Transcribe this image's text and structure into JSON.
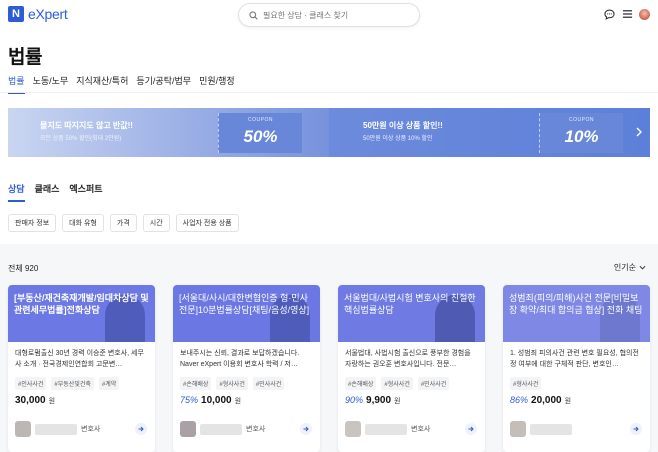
{
  "header": {
    "logo_mark": "N",
    "logo_text": "eXpert",
    "search_placeholder": "필요한 상담 · 클래스 찾기"
  },
  "page_title": "법률",
  "category_tabs": [
    "법률",
    "노동/노무",
    "지식재산/특허",
    "등기/공탁/법무",
    "민원/행정"
  ],
  "banner": {
    "left": {
      "title": "몰지도 따지지도 않고 반값!!",
      "subtitle": "모든 상품 50% 할인(최대 2만원)",
      "coupon_label": "COUPON",
      "coupon_value": "50%"
    },
    "right": {
      "title": "50만원 이상 상품 할인!!",
      "subtitle": "50만원 이상 상품 10% 할인",
      "coupon_label": "COUPON",
      "coupon_value": "10%"
    }
  },
  "sub_tabs": [
    "상담",
    "클래스",
    "엑스퍼트"
  ],
  "filters": [
    "판매자 정보",
    "대화 유형",
    "가격",
    "시간",
    "사업자 전용 상품"
  ],
  "list": {
    "total": "전체 920",
    "sort": "인기순"
  },
  "cards": [
    {
      "title": "[부동산/재건축재개발/임대차상담 및 관련세무법률]전화상담",
      "desc": "대형로펌출신 30년 경력 이승준 변호사, 세무사 소개 · 전국경제인연합회 고문변…",
      "tags": [
        "#인사사건",
        "#부동산및건축",
        "#계약"
      ],
      "discount": "",
      "price": "30,000",
      "won": "원",
      "role": "변호사"
    },
    {
      "title": "[서울대/사시/대한변협인증 형·민사전문]10분법률상담[채팅/음성/영상]",
      "desc": "보내주시는 신뢰, 결과로 보답하겠습니다. Naver eXpert 이용회 변호사 학력 / 저…",
      "tags": [
        "#손해배상",
        "#형사사건",
        "#민사사건"
      ],
      "discount": "75%",
      "price": "10,000",
      "won": "원",
      "role": "변호사"
    },
    {
      "title": "서울법대/사법시험 변호사의 친절한 핵심법률상담",
      "desc": "서울법대, 사법시험 출신으로 풍부한 경험을 자랑하는 권오훈 변호사입니다. 전문…",
      "tags": [
        "#손해배상",
        "#형사사건",
        "#민사사건"
      ],
      "discount": "90%",
      "price": "9,900",
      "won": "원",
      "role": "변호사"
    },
    {
      "title": "성범죄(피의/피해)사건 전문[비밀보장 확약/최대 합의금 협상] 전화 채팅",
      "desc": "1. 성범죄 피의사건 관련 변호 필요성, 협의전정 여부에 대한 구체적 판단, 변호인…",
      "tags": [
        "#형사사건"
      ],
      "discount": "86%",
      "price": "20,000",
      "won": "원",
      "role": ""
    }
  ]
}
